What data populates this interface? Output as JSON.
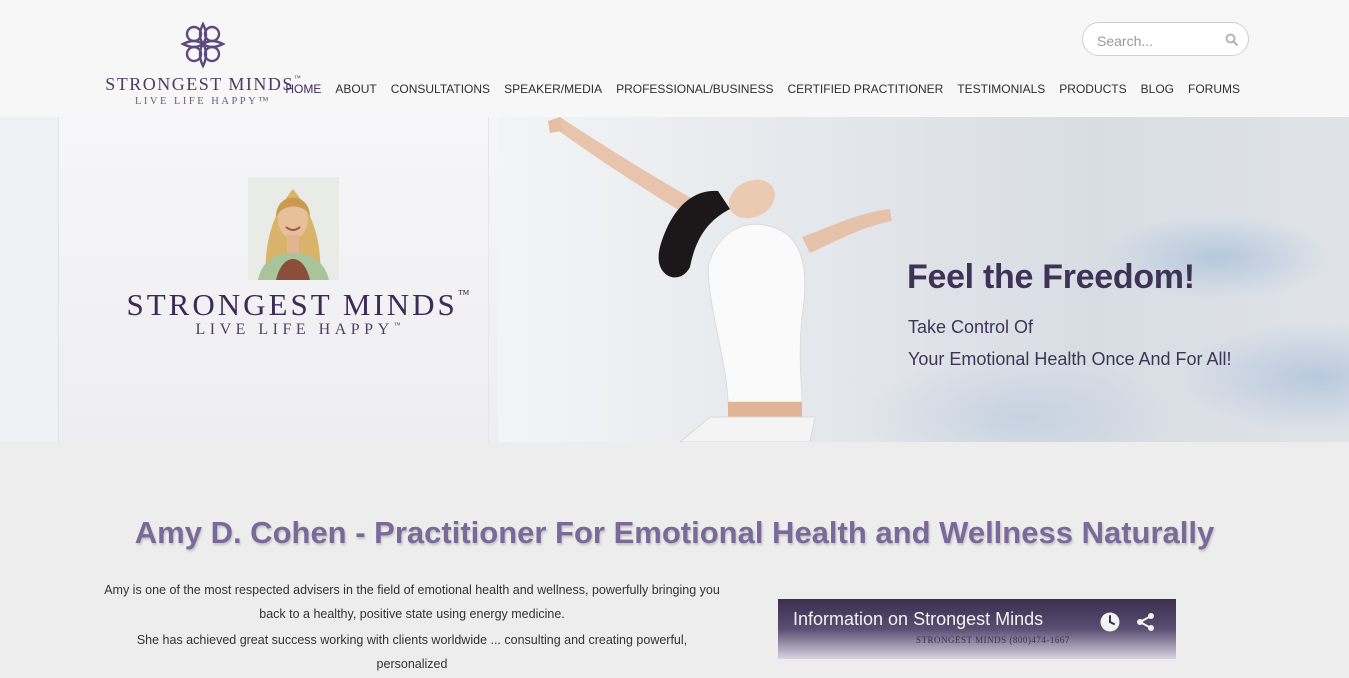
{
  "header": {
    "logo": {
      "name": "STRONGEST MINDS",
      "tm": "™",
      "tagline": "LIVE LIFE HAPPY™",
      "icon": "flower-ornament-icon"
    },
    "search": {
      "placeholder": "Search...",
      "icon": "search-icon"
    },
    "nav": [
      {
        "label": "HOME",
        "active": true
      },
      {
        "label": "ABOUT"
      },
      {
        "label": "CONSULTATIONS"
      },
      {
        "label": "SPEAKER/MEDIA"
      },
      {
        "label": "PROFESSIONAL/BUSINESS"
      },
      {
        "label": "CERTIFIED PRACTITIONER"
      },
      {
        "label": "TESTIMONIALS"
      },
      {
        "label": "PRODUCTS"
      },
      {
        "label": "BLOG"
      },
      {
        "label": "FORUMS"
      }
    ]
  },
  "hero": {
    "brand_name": "STRONGEST MINDS",
    "brand_tm": "™",
    "brand_tagline": "LIVE LIFE HAPPY",
    "brand_tagline_tm": "™",
    "headline": "Feel the Freedom!",
    "sub_line_1": "Take Control Of",
    "sub_line_2": "Your Emotional Health Once And For All!"
  },
  "main": {
    "title": "Amy D. Cohen - Practitioner For Emotional Health and Wellness Naturally",
    "intro_p1": "Amy is one of the most respected advisers in the field of emotional health  and wellness, powerfully bringing you back to a healthy, positive state  using energy medicine.",
    "intro_p2": "She has achieved great success working with clients worldwide ... consulting and creating powerful, personalized"
  },
  "video": {
    "title": "Information on Strongest Minds",
    "subtitle": "STRONGEST MINDS (800)474-1667"
  },
  "colors": {
    "brand_purple": "#3e3357",
    "title_purple": "#7a6a9a",
    "background": "#ededed"
  }
}
